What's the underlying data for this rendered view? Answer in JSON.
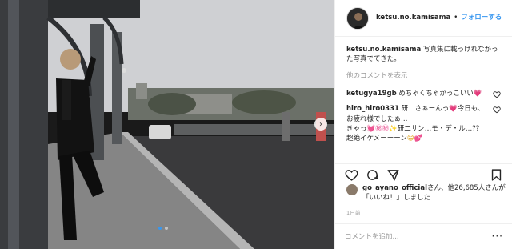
{
  "post": {
    "photo_alt": "man in black suit leaning on bridge pillar",
    "carousel": {
      "current": 1,
      "total": 2
    }
  },
  "header": {
    "username": "ketsu.no.kamisama",
    "separator": "•",
    "follow_label": "フォローする"
  },
  "caption": {
    "username": "ketsu.no.kamisama",
    "text": " 写真集に載っけれなかった写真でてきた。"
  },
  "view_more_label": "他のコメントを表示",
  "comments": [
    {
      "username": "ketugya19gb",
      "text": " めちゃくちゃかっこいい",
      "emoji": "💗"
    },
    {
      "username": "hiro_hiro0331",
      "text": " 研二さぁーんっ",
      "emoji": "💗",
      "text2": "今日も、お疲れ様でしたぁ…",
      "line3": "きゃっ",
      "emoji2": "💓㊙㊙",
      "line3b": "✨研二サン…モ・デ・ル…??",
      "line4": "超絶イケメーーーン",
      "emoji3": "😁💕"
    }
  ],
  "likes": {
    "username": "go_ayano_official",
    "text": "さん、他26,685人さんが「いいね！」しました"
  },
  "time_label": "1日前",
  "add_comment": {
    "placeholder": "コメントを追加...",
    "more_label": "···"
  },
  "icons": {
    "like": "heart-icon",
    "comment": "comment-icon",
    "share": "share-icon",
    "save": "bookmark-icon",
    "next": "chevron-right-icon"
  },
  "colors": {
    "link": "#3897f0",
    "muted": "#999999",
    "text": "#262626"
  }
}
